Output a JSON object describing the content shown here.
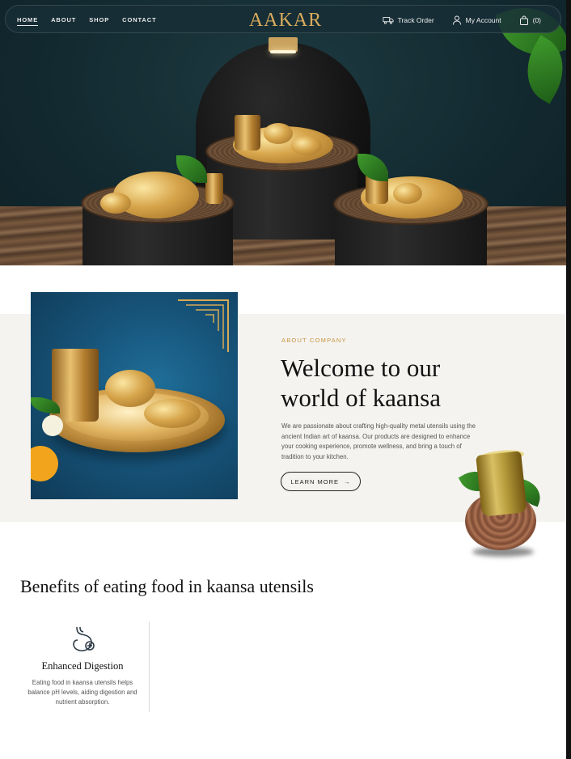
{
  "nav": {
    "links": [
      "HOME",
      "ABOUT",
      "SHOP",
      "CONTACT"
    ],
    "logo": "AAKAR",
    "track_order": "Track Order",
    "my_account": "My Account",
    "cart_count": "(0)"
  },
  "about": {
    "eyebrow": "ABOUT COMPANY",
    "title": "Welcome to our world of kaansa",
    "body": "We are passionate about crafting high-quality metal utensils using the ancient Indian art of kaansa. Our products are designed to enhance your cooking experience, promote wellness, and bring a touch of tradition to your kitchen.",
    "button": "LEARN MORE",
    "button_arrow": "→"
  },
  "benefits": {
    "title": "Benefits of eating food in kaansa utensils",
    "items": [
      {
        "icon": "stomach-icon",
        "title": "Enhanced Digestion",
        "text": "Eating food in kaansa utensils helps balance pH levels, aiding digestion and nutrient absorption."
      }
    ]
  },
  "colors": {
    "hero_bg": "#132a31",
    "gold_accent": "#d9ab5c",
    "eyebrow": "#c8953f",
    "band_bg": "#f4f3f0"
  }
}
